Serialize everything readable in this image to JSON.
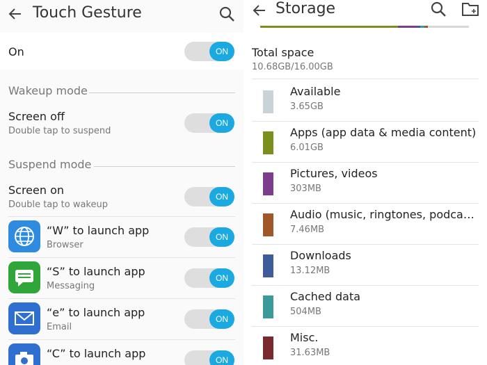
{
  "touch_gesture": {
    "title": "Touch Gesture",
    "master": {
      "label": "On",
      "toggle": "ON"
    },
    "wakeup_section": "Wakeup mode",
    "suspend_section": "Suspend mode",
    "rows": [
      {
        "title": "Screen off",
        "subtitle": "Double tap to suspend",
        "toggle": "ON"
      },
      {
        "title": "Screen on",
        "subtitle": "Double tap to wakeup",
        "toggle": "ON"
      },
      {
        "title": "“W” to launch app",
        "subtitle": "Browser",
        "toggle": "ON",
        "icon": "globe-icon",
        "icon_color": "#2f8be0"
      },
      {
        "title": "“S” to launch app",
        "subtitle": "Messaging",
        "toggle": "ON",
        "icon": "message-icon",
        "icon_color": "#2fa53a"
      },
      {
        "title": "“e” to launch app",
        "subtitle": "Email",
        "toggle": "ON",
        "icon": "mail-icon",
        "icon_color": "#2f6fcf"
      },
      {
        "title": "“C” to launch app",
        "subtitle": "",
        "toggle": "ON",
        "icon": "camera-icon",
        "icon_color": "#2f6fcf"
      }
    ],
    "accent_color": "#1ba9e1"
  },
  "storage": {
    "title": "Storage",
    "total_label": "Total space",
    "total_value": "10.68GB/16.00GB",
    "items": [
      {
        "name": "Available",
        "size": "3.65GB",
        "color": "#c9d3d7"
      },
      {
        "name": "Apps (app data & media content)",
        "size": "6.01GB",
        "color": "#7b8f1e"
      },
      {
        "name": "Pictures, videos",
        "size": "303MB",
        "color": "#7c3d8c"
      },
      {
        "name": "Audio (music, ringtones, podcasts, etc.)",
        "size": "7.46MB",
        "color": "#a0572a"
      },
      {
        "name": "Downloads",
        "size": "13.12MB",
        "color": "#3f5c9a"
      },
      {
        "name": "Cached data",
        "size": "504MB",
        "color": "#3d9a9a"
      },
      {
        "name": "Misc.",
        "size": "31.63MB",
        "color": "#7a2a2e"
      }
    ]
  }
}
